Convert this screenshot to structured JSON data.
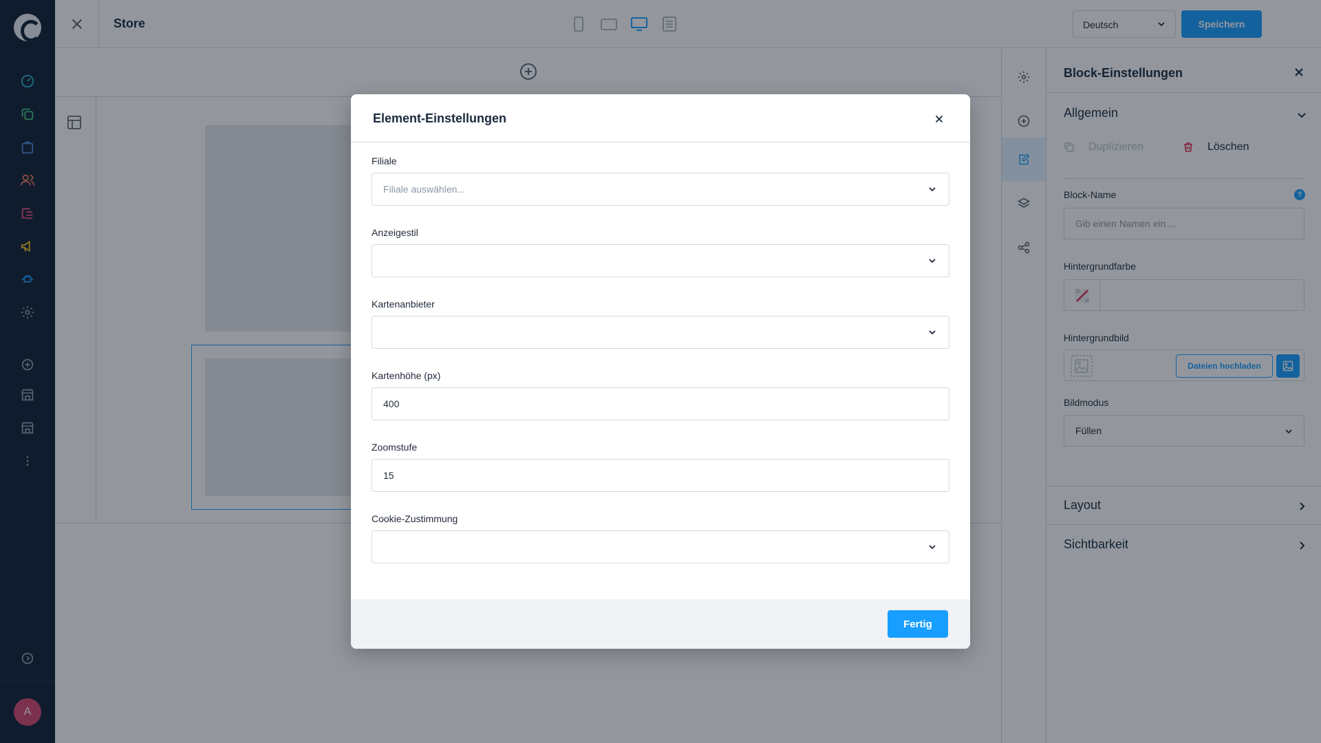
{
  "app": {
    "user_initial": "A",
    "nav_icons": [
      "dashboard-icon",
      "catalogue-icon",
      "orders-icon",
      "customers-icon",
      "content-icon",
      "marketing-icon",
      "extensions-icon",
      "settings-icon",
      "add-icon",
      "store-icon",
      "store-icon",
      "more-icon",
      "expand-icon"
    ]
  },
  "topbar": {
    "title": "Store",
    "devices": [
      "mobile-icon",
      "tablet-icon",
      "desktop-icon",
      "list-view-icon"
    ],
    "active_device": "desktop-icon",
    "language": "Deutsch",
    "save_label": "Speichern"
  },
  "sidebar_icons": [
    "settings-icon",
    "add-icon",
    "edit-icon",
    "layers-icon",
    "share-icon"
  ],
  "block_panel": {
    "title": "Block-Einstellungen",
    "sections": {
      "general": "Allgemein",
      "layout": "Layout",
      "visibility": "Sichtbarkeit"
    },
    "actions": {
      "duplicate": "Duplizieren",
      "delete": "Löschen"
    },
    "block_name": {
      "label": "Block-Name",
      "placeholder": "Gib einen Namen ein ..."
    },
    "background_color": {
      "label": "Hintergrundfarbe",
      "value": ""
    },
    "background_image": {
      "label": "Hintergrundbild",
      "upload_label": "Dateien hochladen"
    },
    "image_mode": {
      "label": "Bildmodus",
      "value": "Füllen"
    }
  },
  "modal": {
    "title": "Element-Einstellungen",
    "fields": [
      {
        "label": "Filiale",
        "value": "Filiale auswählen...",
        "type": "select",
        "placeholder": true
      },
      {
        "label": "Anzeigestil",
        "value": "",
        "type": "select"
      },
      {
        "label": "Kartenanbieter",
        "value": "",
        "type": "select"
      },
      {
        "label": "Kartenhöhe (px)",
        "value": "400",
        "type": "input"
      },
      {
        "label": "Zoomstufe",
        "value": "15",
        "type": "input"
      },
      {
        "label": "Cookie-Zustimmung",
        "value": "",
        "type": "select"
      }
    ],
    "done_label": "Fertig"
  },
  "colors": {
    "accent": "#189eff",
    "nav_bg": "#0f1f33",
    "danger": "#de294c",
    "avatar": "#d5476f"
  }
}
